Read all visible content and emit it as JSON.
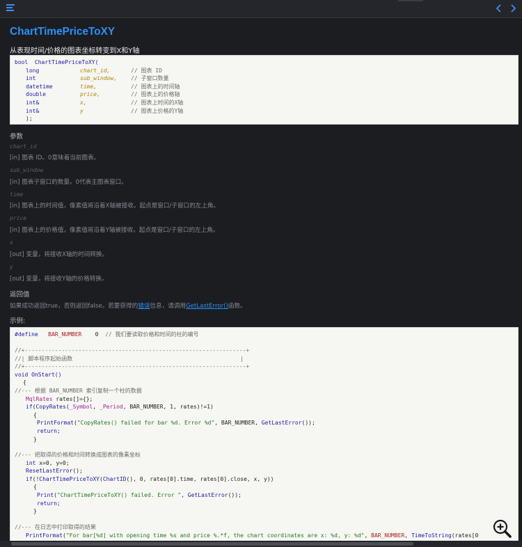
{
  "page": {
    "title": "ChartTimePriceToXY",
    "subtitle": "从表现时间/价格的图表坐标转变到X和Y轴"
  },
  "signature": [
    {
      "a": "bool",
      "b": "ChartTimePriceToXY(",
      "c": ""
    },
    {
      "a": "long",
      "b": "chart_id,",
      "c": "// 图表 ID"
    },
    {
      "a": "int",
      "b": "sub_window,",
      "c": "// 子窗口数量"
    },
    {
      "a": "datetime",
      "b": "time,",
      "c": "// 图表上的时间轴"
    },
    {
      "a": "double",
      "b": "price,",
      "c": "// 图表上的价格轴"
    },
    {
      "a": "int&",
      "b": "x,",
      "c": "// 图表上时间的X轴"
    },
    {
      "a": "int&",
      "b": "y",
      "c": "// 图表上价格的Y轴"
    },
    {
      "a": ");",
      "b": "",
      "c": ""
    }
  ],
  "params_heading": "参数",
  "params": [
    {
      "name": "chart_id",
      "desc": "[in]  图表 ID。0意味着当前图表。"
    },
    {
      "name": "sub_window",
      "desc": "[in]  图表子窗口的数量。0代表主图表窗口。"
    },
    {
      "name": "time",
      "desc": "[in]  图表上的时间值，像素值将沿着X轴被接收。起点是窗口/子窗口的左上角。"
    },
    {
      "name": "price",
      "desc": "[in]   图表上的价格值，像素值将沿着Y轴被接收。起点是窗口/子窗口的左上角。"
    },
    {
      "name": "x",
      "desc": "[out]  变量，将接收X轴的时间转换。"
    },
    {
      "name": "y",
      "desc": "[out]  变量，将接收Y轴的价格转换。"
    }
  ],
  "return_heading": "返回值",
  "return_text": {
    "before": "如果成功返回true，否则返回false。若要获得的",
    "link1": "错误",
    "middle": "信息，请调用",
    "link2": "GetLastError()",
    "after": "函数。"
  },
  "example_heading": "示例:",
  "example": {
    "l1": {
      "a": "#define",
      "b": "BAR_NUMBER",
      "c": "0",
      "d": "// 我们要读取价格和时间的柱的编号"
    },
    "l2": "//+------------------------------------------------------------------+",
    "l3": "//| 脚本程序起始函数                                                  |",
    "l4": "//+------------------------------------------------------------------+",
    "l5": {
      "a": "void",
      "b": "OnStart()"
    },
    "l6": "{",
    "l7": "//--- 根据 BAR_NUMBER 索引复制一个柱的数据",
    "l8": {
      "a": "MqlRates",
      "b": "rates[]={};"
    },
    "l9": {
      "a": "if",
      "b": "(",
      "c": "CopyRates",
      "d": "(",
      "e": "_Symbol",
      "f": ", ",
      "g": "_Period",
      "h": ", BAR_NUMBER, 1, rates)!=1)"
    },
    "l10": "{",
    "l11": {
      "a": "PrintFormat",
      "b": "(",
      "c": "\"CopyRates() failed for bar %d. Error %d\"",
      "d": ", BAR_NUMBER, ",
      "e": "GetLastError",
      "f": "());"
    },
    "l12": "return;",
    "l13": "}",
    "l14": "//--- 把取得的价格和时间转换成图表的像素坐标",
    "l15": {
      "a": "int",
      "b": "x=0, y=0;"
    },
    "l16": {
      "a": "ResetLastError",
      "b": "();"
    },
    "l17": {
      "a": "if",
      "b": "(!",
      "c": "ChartTimePriceToXY",
      "d": "(",
      "e": "ChartID",
      "f": "(), 0, rates[0].time, rates[0].close, x, y))"
    },
    "l18": "{",
    "l19": {
      "a": "Print",
      "b": "(",
      "c": "\"ChartTimePriceToXY() failed. Error \"",
      "d": ", ",
      "e": "GetLastError",
      "f": "());"
    },
    "l20": "return;",
    "l21": "}",
    "l22": "//--- 在日志中打印取得的结果",
    "l23": {
      "a": "PrintFormat",
      "b": "(",
      "c": "\"For bar[%d] with opening time %s and price %.*f, the chart coordinates are x: %d, y: %d\"",
      "d": ", ",
      "e": "BAR_NUMBER",
      "f": ", ",
      "g": "TimeToString",
      "h": "(rates[0"
    }
  },
  "colors": {
    "accent": "#2e8ff5",
    "background": "#1b1d21",
    "code_bg": "#f6f6f3"
  },
  "icons": {
    "menu": "hamburger-icon",
    "back": "chevron-left-icon",
    "forward": "chevron-right-icon",
    "zoom": "zoom-in-icon"
  }
}
